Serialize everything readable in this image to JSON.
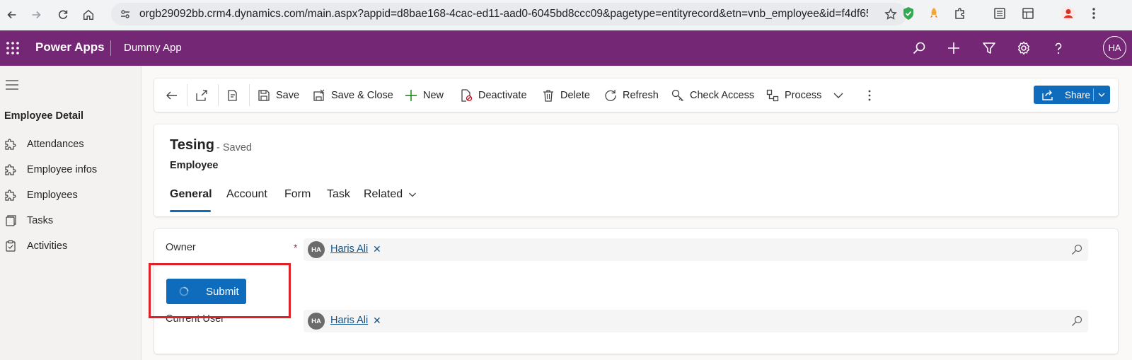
{
  "browser": {
    "url": "orgb29092bb.crm4.dynamics.com/main.aspx?appid=d8bae168-4cac-ed11-aad0-6045bd8ccc09&pagetype=entityrecord&etn=vnb_employee&id=f4df65fe-9ef..."
  },
  "header": {
    "app_name": "Power Apps",
    "sub_app": "Dummy App",
    "avatar_initials": "HA",
    "brand_color": "#742774"
  },
  "sidebar": {
    "title": "Employee Detail",
    "items": [
      {
        "label": "Attendances",
        "icon": "puzzle-icon"
      },
      {
        "label": "Employee infos",
        "icon": "puzzle-icon"
      },
      {
        "label": "Employees",
        "icon": "puzzle-icon"
      },
      {
        "label": "Tasks",
        "icon": "tasks-icon"
      },
      {
        "label": "Activities",
        "icon": "clipboard-icon"
      }
    ]
  },
  "commandbar": {
    "save": "Save",
    "save_close": "Save & Close",
    "new": "New",
    "deactivate": "Deactivate",
    "delete": "Delete",
    "refresh": "Refresh",
    "check_access": "Check Access",
    "process": "Process",
    "share": "Share"
  },
  "record": {
    "title": "Tesing",
    "status": "- Saved",
    "entity": "Employee",
    "tabs": [
      "General",
      "Account",
      "Form",
      "Task",
      "Related"
    ]
  },
  "form": {
    "owner_label": "Owner",
    "required_mark": "*",
    "owner_initials": "HA",
    "owner_name": "Haris Ali",
    "remove_glyph": "✕",
    "submit_label": "Submit",
    "current_user_label": "Current User",
    "current_user_initials": "HA",
    "current_user_name": "Haris Ali"
  }
}
